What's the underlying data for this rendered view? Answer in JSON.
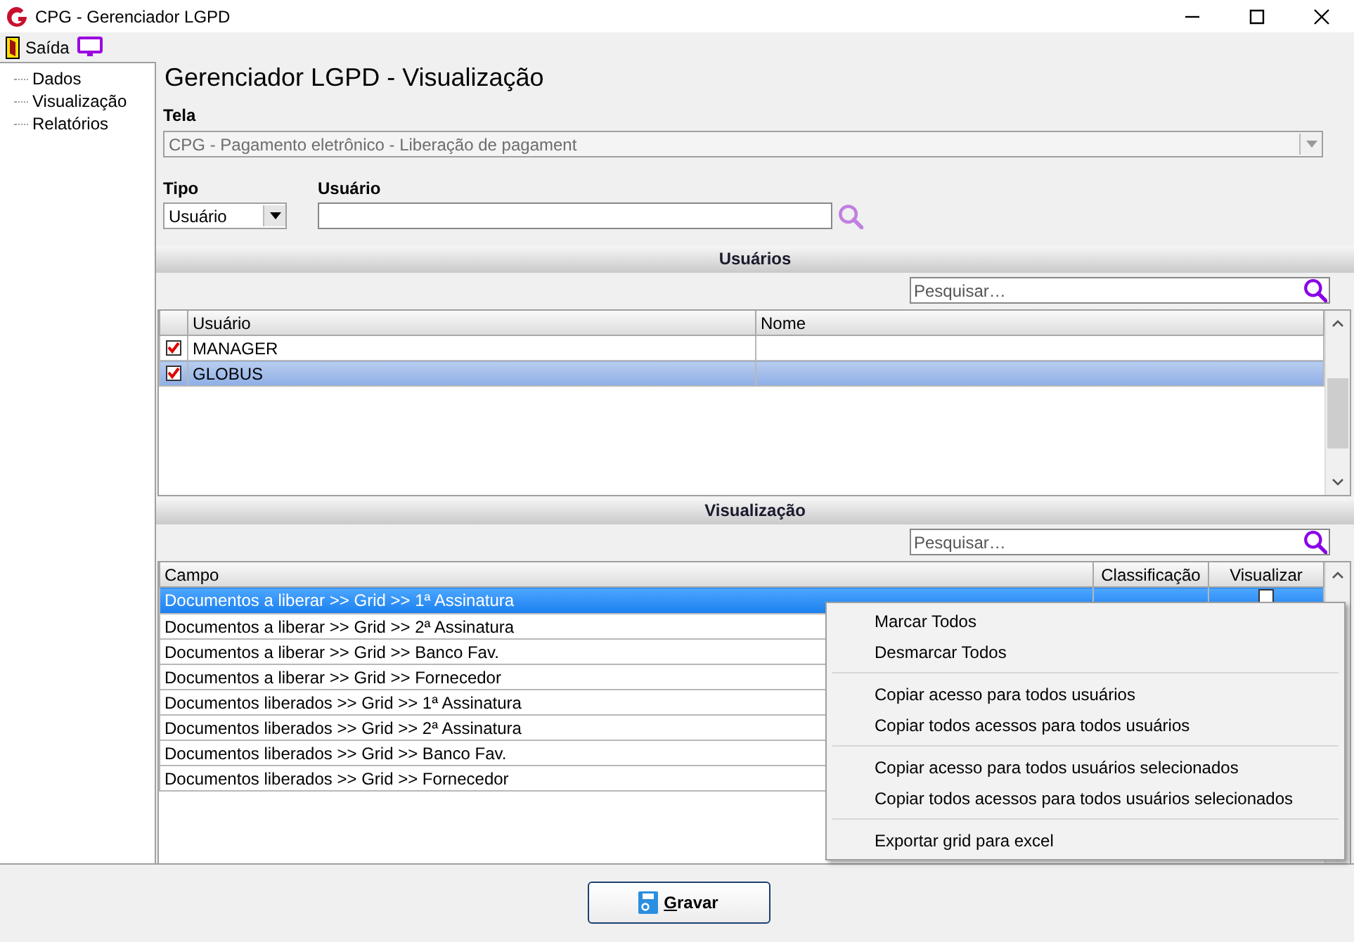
{
  "window": {
    "title": "CPG - Gerenciador LGPD"
  },
  "toolbar": {
    "exit_label": "Saída"
  },
  "sidebar": {
    "items": [
      {
        "label": "Dados"
      },
      {
        "label": "Visualização"
      },
      {
        "label": "Relatórios"
      }
    ]
  },
  "page_title": "Gerenciador LGPD - Visualização",
  "tela": {
    "label": "Tela",
    "value": "CPG - Pagamento eletrônico - Liberação de pagament",
    "disabled": true
  },
  "tipo": {
    "label": "Tipo",
    "value": "Usuário"
  },
  "usuario": {
    "label": "Usuário"
  },
  "users_section": {
    "title": "Usuários",
    "search": {
      "placeholder": "Pesquisar…"
    },
    "columns": [
      "Usuário",
      "Nome"
    ],
    "rows": [
      {
        "usuario": "MANAGER",
        "checked": true,
        "selected": false
      },
      {
        "usuario": "GLOBUS",
        "checked": true,
        "selected": true
      }
    ]
  },
  "view_section": {
    "title": "Visualização",
    "search": {
      "placeholder": "Pesquisar…"
    },
    "columns": [
      "Campo",
      "Classificação",
      "Visualizar"
    ],
    "rows": [
      {
        "campo": "Documentos a liberar >> Grid >> 1ª Assinatura",
        "visualizar": false,
        "selected": true
      },
      {
        "campo": "Documentos a liberar >> Grid >> 2ª Assinatura",
        "selected": false
      },
      {
        "campo": "Documentos a liberar >> Grid >> Banco Fav.",
        "selected": false
      },
      {
        "campo": "Documentos a liberar >> Grid >> Fornecedor",
        "selected": false
      },
      {
        "campo": "Documentos liberados >> Grid >> 1ª Assinatura",
        "selected": false
      },
      {
        "campo": "Documentos liberados >> Grid >> 2ª Assinatura",
        "selected": false
      },
      {
        "campo": "Documentos liberados >> Grid >> Banco Fav.",
        "selected": false
      },
      {
        "campo": "Documentos liberados >> Grid >> Fornecedor",
        "selected": false
      }
    ]
  },
  "context_menu": {
    "groups": [
      [
        "Marcar Todos",
        "Desmarcar Todos"
      ],
      [
        "Copiar acesso para todos usuários",
        "Copiar todos acessos para todos usuários"
      ],
      [
        "Copiar acesso para todos usuários selecionados",
        "Copiar todos acessos para todos usuários selecionados"
      ],
      [
        "Exportar grid para excel"
      ]
    ]
  },
  "save_button": {
    "label": "Gravar"
  }
}
